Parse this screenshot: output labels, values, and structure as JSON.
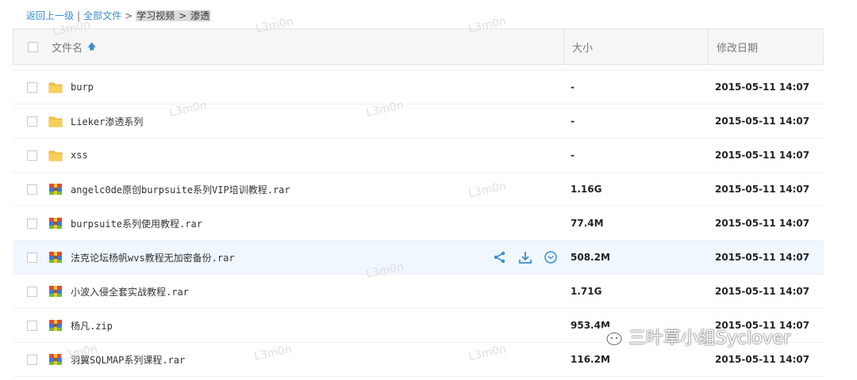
{
  "breadcrumb": {
    "back": "返回上一级",
    "divider": "|",
    "root": "全部文件",
    "arrow1": ">",
    "folder1": "学习视频",
    "arrow2": ">",
    "current": "渗透"
  },
  "table": {
    "headers": {
      "name": "文件名",
      "size": "大小",
      "modified": "修改日期"
    },
    "rows": [
      {
        "name": "burp",
        "size": "-",
        "date": "2015-05-11 14:07",
        "icon": "folder-icon"
      },
      {
        "name": "Lieker渗透系列",
        "size": "-",
        "date": "2015-05-11 14:07",
        "icon": "folder-icon"
      },
      {
        "name": "xss",
        "size": "-",
        "date": "2015-05-11 14:07",
        "icon": "folder-icon"
      },
      {
        "name": "angelc0de原创burpsuite系列VIP培训教程.rar",
        "size": "1.16G",
        "date": "2015-05-11 14:07",
        "icon": "rar-archive-icon"
      },
      {
        "name": "burpsuite系列使用教程.rar",
        "size": "77.4M",
        "date": "2015-05-11 14:07",
        "icon": "rar-archive-icon"
      },
      {
        "name": "法克论坛杨帆wvs教程无加密备份.rar",
        "size": "508.2M",
        "date": "2015-05-11 14:07",
        "icon": "rar-archive-icon"
      },
      {
        "name": "小波入侵全套实战教程.rar",
        "size": "1.71G",
        "date": "2015-05-11 14:07",
        "icon": "rar-archive-icon"
      },
      {
        "name": "杨凡.zip",
        "size": "953.4M",
        "date": "2015-05-11 14:07",
        "icon": "zip-archive-icon"
      },
      {
        "name": "羽翼SQLMAP系列课程.rar",
        "size": "116.2M",
        "date": "2015-05-11 14:07",
        "icon": "rar-archive-icon"
      }
    ]
  },
  "watermark": "L3m0n",
  "brand": "三叶草小组Syclover",
  "colors": {
    "link": "#3b8cd1",
    "folder": "#f5c343",
    "hover_row": "#f0f7ff"
  }
}
